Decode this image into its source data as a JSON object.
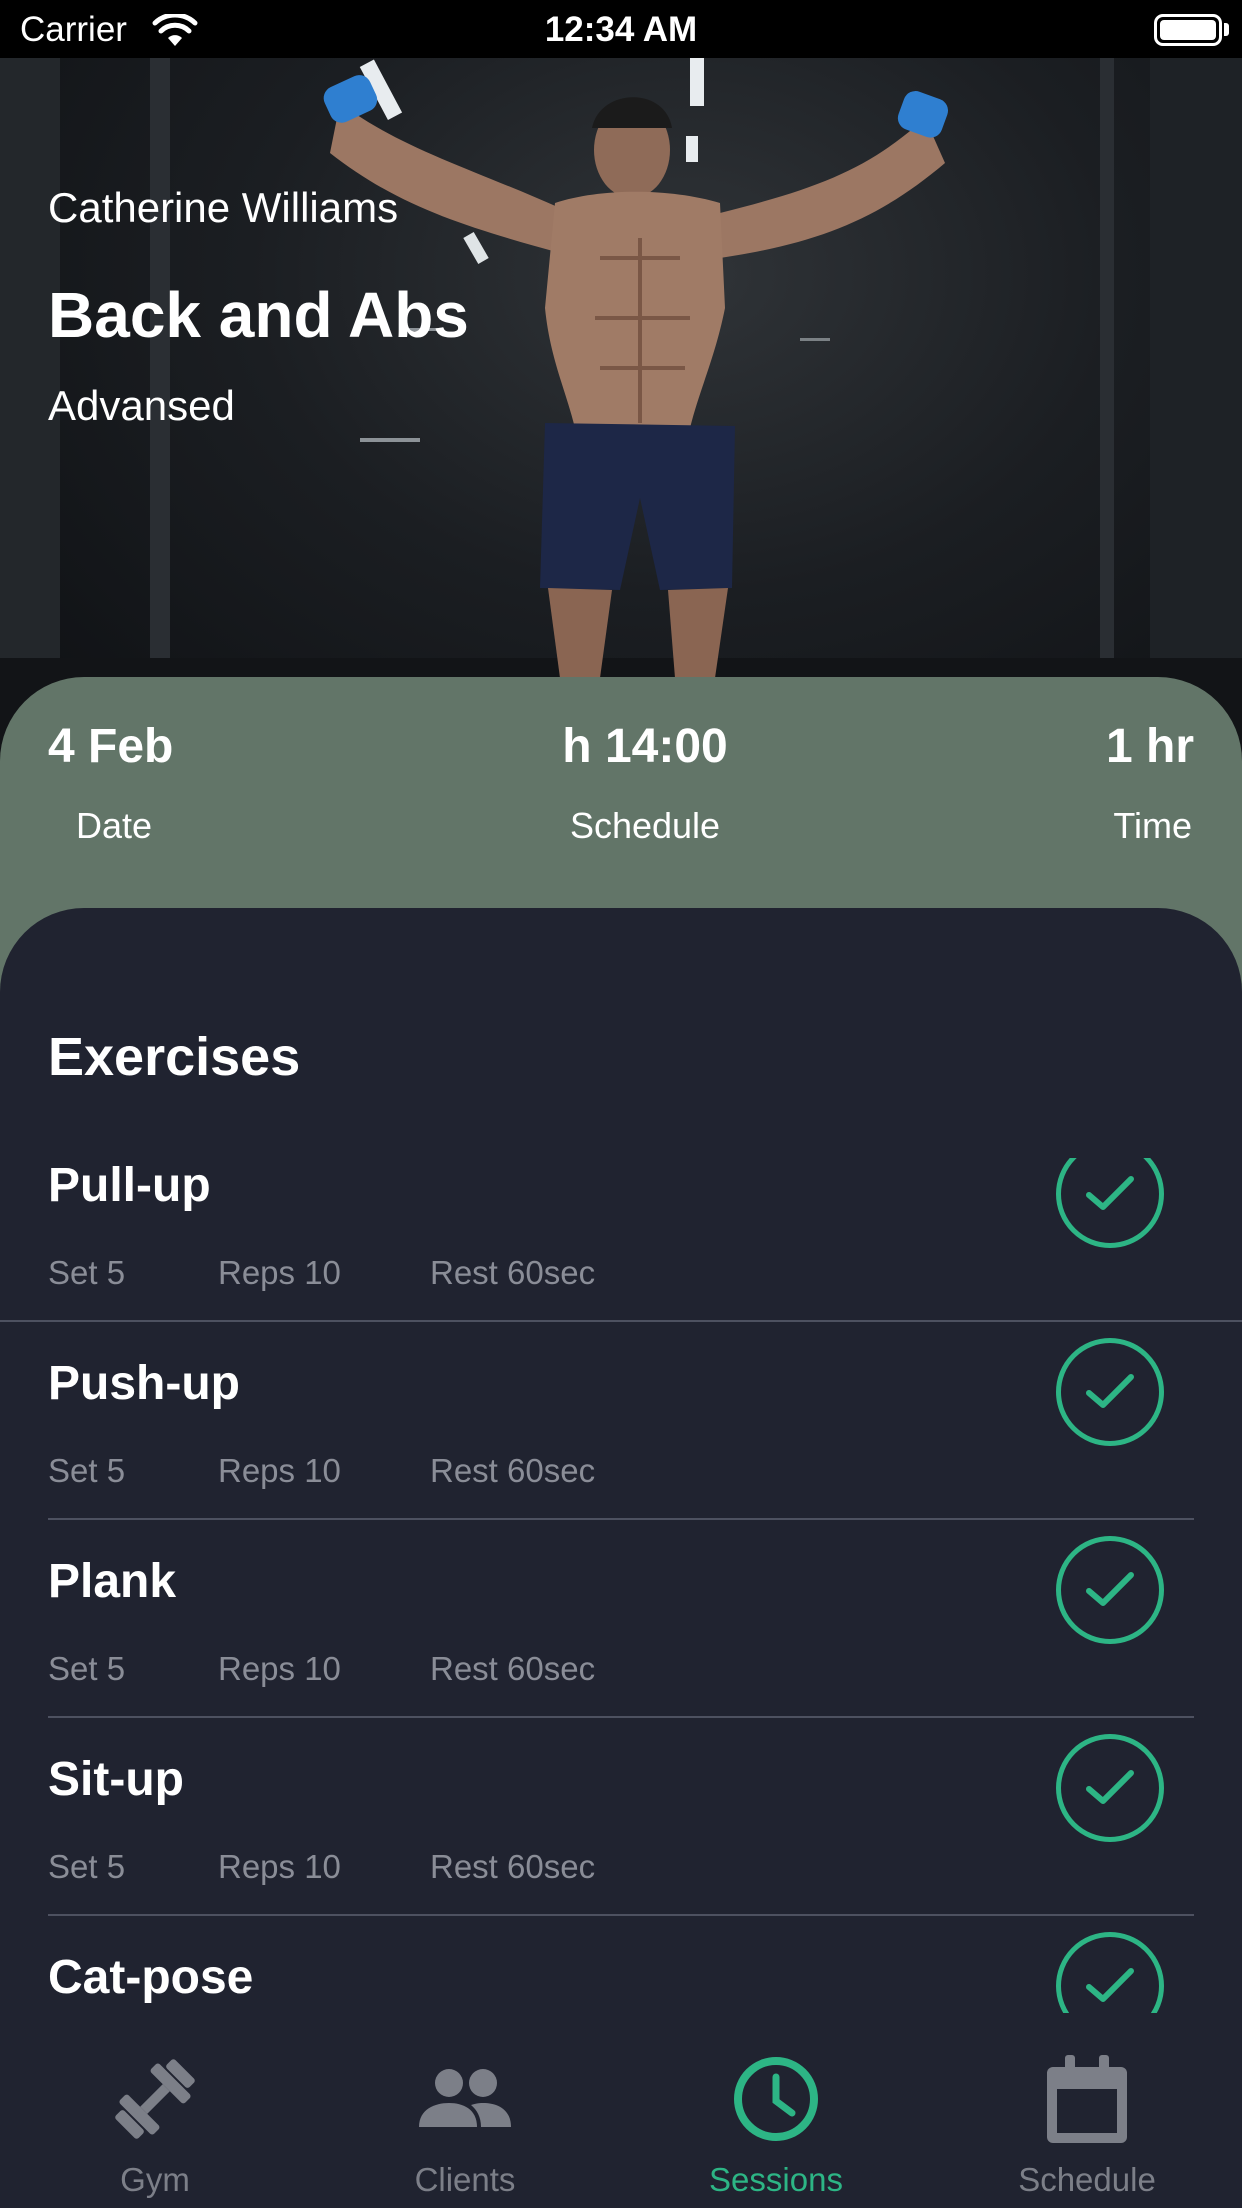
{
  "status_bar": {
    "carrier": "Carrier",
    "time": "12:34 AM"
  },
  "hero": {
    "trainer_name": "Catherine Williams",
    "title": "Back and Abs",
    "level": "Advansed"
  },
  "info": [
    {
      "value": "4 Feb",
      "label": "Date"
    },
    {
      "value": "h 14:00",
      "label": "Schedule"
    },
    {
      "value": "1 hr",
      "label": "Time"
    }
  ],
  "exercises": {
    "title": "Exercises",
    "items": [
      {
        "name": "Pull-up",
        "sets": "Set 5",
        "reps": "Reps 10",
        "rest": "Rest 60sec",
        "done": true
      },
      {
        "name": "Push-up",
        "sets": "Set 5",
        "reps": "Reps 10",
        "rest": "Rest 60sec",
        "done": true
      },
      {
        "name": "Plank",
        "sets": "Set 5",
        "reps": "Reps 10",
        "rest": "Rest 60sec",
        "done": true
      },
      {
        "name": "Sit-up",
        "sets": "Set 5",
        "reps": "Reps 10",
        "rest": "Rest 60sec",
        "done": true
      },
      {
        "name": "Cat-pose",
        "sets": "",
        "reps": "",
        "rest": "",
        "done": true
      }
    ]
  },
  "tabs": [
    {
      "label": "Gym",
      "icon": "dumbbell-icon",
      "active": false
    },
    {
      "label": "Clients",
      "icon": "people-icon",
      "active": false
    },
    {
      "label": "Sessions",
      "icon": "clock-icon",
      "active": true
    },
    {
      "label": "Schedule",
      "icon": "calendar-icon",
      "active": false
    }
  ],
  "colors": {
    "accent": "#2db585",
    "card": "#627568",
    "background": "#202330",
    "inactive": "#7c7f88"
  }
}
